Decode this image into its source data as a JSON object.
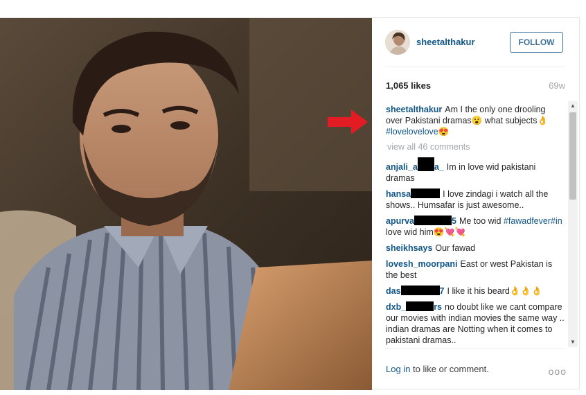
{
  "post": {
    "username": "sheetalthakur",
    "follow_label": "FOLLOW",
    "likes": "1,065 likes",
    "age": "69w"
  },
  "caption": {
    "user": "sheetalthakur",
    "text_pre": "Am I the only one drooling over Pakistani dramas",
    "emoji_1": "😮",
    "text_mid": " what subjects",
    "emoji_2": "👌",
    "hashtag": "#lovelovelove",
    "emoji_3": "😍"
  },
  "view_all": "view all 46 comments",
  "comments": [
    {
      "user_pre": "anjali_a",
      "user_post": "a_",
      "text": "Im in love wid pakistani dramas"
    },
    {
      "user_pre": "hansa",
      "user_post": "",
      "text": "I love zindagi i watch all the shows.. Humsafar is just awesome.."
    },
    {
      "user_pre": "apurva",
      "user_post": "5",
      "hashtag": "#fawadfever#in",
      "text": " love wid him",
      "text_pre": "Me too wid",
      "emoji": "😍💘💘"
    },
    {
      "user": "sheikhsays",
      "text": "Our fawad"
    },
    {
      "user": "lovesh_moorpani",
      "text": "East or west Pakistan is the best"
    },
    {
      "user_pre": "das",
      "user_post": "7",
      "text": "I like it his beard",
      "emoji": "👌👌👌"
    },
    {
      "user_pre": "dxb_",
      "user_post": "rs",
      "text": "no doubt like we cant compare our movies with indian movies the same way .. indian dramas are Notting when it comes to pakistani dramas.."
    }
  ],
  "footer": {
    "login_label": "Log in",
    "rest": " to like or comment.",
    "more": "ooo"
  },
  "icons": {
    "arrow": "red-arrow-icon",
    "more": "more-options-icon"
  },
  "colors": {
    "link": "#125688",
    "follow": "#3f729b",
    "arrow": "#e31b23"
  }
}
